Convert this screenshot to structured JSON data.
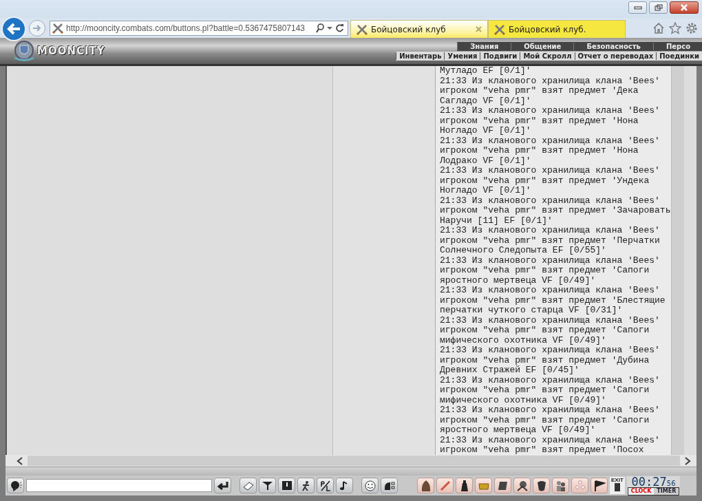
{
  "browser": {
    "address": "http://mooncity.combats.com/buttons.pl?battle=0.5367475807143",
    "tabs": [
      {
        "title": "Бойцовский клуб",
        "selected": true,
        "closable": true
      },
      {
        "title": "Бойцовский клуб.",
        "selected": false,
        "closable": false
      }
    ]
  },
  "header": {
    "logo": "MOONCITY",
    "top_menu": [
      "Знания",
      "Общение",
      "Безопасность",
      "Персо"
    ],
    "sub_menu": [
      "Инвентарь",
      "Умения",
      "Подвиги",
      "Мой Скролл",
      "Отчет о переводах",
      "Поединки"
    ]
  },
  "log": [
    "Мутладо EF [0/1]'",
    "21:33 Из кланового хранилища клана 'Bees' игроком \"veha pmr\" взят предмет 'Дека Сагладо VF [0/1]'",
    "21:33 Из кланового хранилища клана 'Bees' игроком \"veha pmr\" взят предмет 'Нона Ногладо VF [0/1]'",
    "21:33 Из кланового хранилища клана 'Bees' игроком \"veha pmr\" взят предмет 'Нона Лодрако VF [0/1]'",
    "21:33 Из кланового хранилища клана 'Bees' игроком \"veha pmr\" взят предмет 'Ундека Ноглaдо VF [0/1]'",
    "21:33 Из кланового хранилища клана 'Bees' игроком \"veha pmr\" взят предмет 'Зачаровать Наручи [11] EF [0/1]'",
    "21:33 Из кланового хранилища клана 'Bees' игроком \"veha pmr\" взят предмет 'Перчатки Солнечного Следопыта EF [0/55]'",
    "21:33 Из кланового хранилища клана 'Bees' игроком \"veha pmr\" взят предмет 'Сапоги яростного мертвеца VF [0/49]'",
    "21:33 Из кланового хранилища клана 'Bees' игроком \"veha pmr\" взят предмет 'Блестящие перчатки чуткого старца VF [0/31]'",
    "21:33 Из кланового хранилища клана 'Bees' игроком \"veha pmr\" взят предмет 'Сапоги мифического охотника VF [0/49]'",
    "21:33 Из кланового хранилища клана 'Bees' игроком \"veha pmr\" взят предмет 'Дубина Древних Стражей EF [0/45]'",
    "21:33 Из кланового хранилища клана 'Bees' игроком \"veha pmr\" взят предмет 'Сапоги мифического охотника VF [0/49]'",
    "21:33 Из кланового хранилища клана 'Bees' игроком \"veha pmr\" взят предмет 'Сапоги яростного мертвеца VF [0/49]'",
    "21:33 Из кланового хранилища клана 'Bees' игроком \"veha pmr\" взят предмет 'Посох"
  ],
  "toolbar": {
    "exit": "EXIT",
    "clock": {
      "time": "00:27",
      "seconds": "56",
      "modes": [
        {
          "label": "CLOCK",
          "selected": true
        },
        {
          "label": "TIMER",
          "selected": false
        }
      ]
    }
  }
}
